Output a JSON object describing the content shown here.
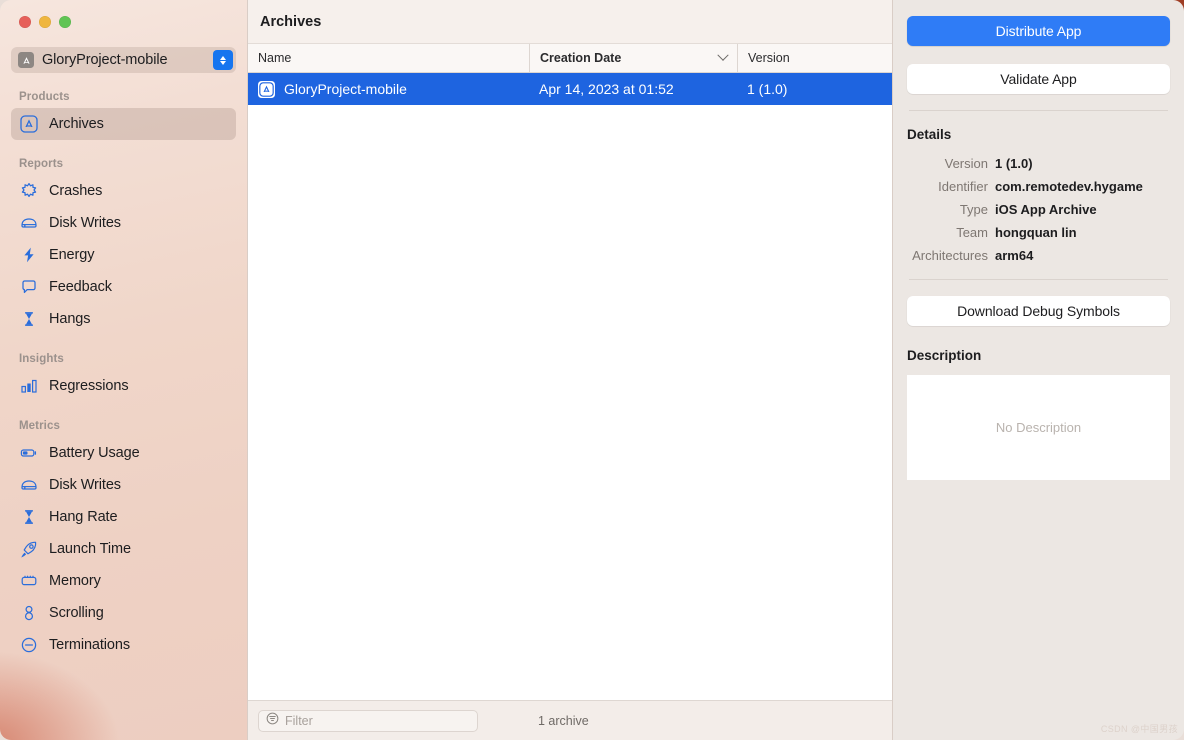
{
  "window": {
    "traffic_lights": [
      {
        "name": "close",
        "color": "#e6605a"
      },
      {
        "name": "minimize",
        "color": "#efb63f"
      },
      {
        "name": "zoom",
        "color": "#61c454"
      }
    ]
  },
  "sidebar": {
    "project_selector": {
      "label": "GloryProject-mobile",
      "icon": "xcode-project-icon",
      "stepper_icon": "up-down-chevron-icon"
    },
    "sections": [
      {
        "title": "Products",
        "items": [
          {
            "label": "Archives",
            "icon": "archive-box-icon",
            "selected": true
          }
        ]
      },
      {
        "title": "Reports",
        "items": [
          {
            "label": "Crashes",
            "icon": "crash-burst-icon",
            "selected": false
          },
          {
            "label": "Disk Writes",
            "icon": "disk-drive-icon",
            "selected": false
          },
          {
            "label": "Energy",
            "icon": "lightning-bolt-icon",
            "selected": false
          },
          {
            "label": "Feedback",
            "icon": "speech-bubble-icon",
            "selected": false
          },
          {
            "label": "Hangs",
            "icon": "hourglass-icon",
            "selected": false
          }
        ]
      },
      {
        "title": "Insights",
        "items": [
          {
            "label": "Regressions",
            "icon": "bar-chart-icon",
            "selected": false
          }
        ]
      },
      {
        "title": "Metrics",
        "items": [
          {
            "label": "Battery Usage",
            "icon": "battery-icon",
            "selected": false
          },
          {
            "label": "Disk Writes",
            "icon": "disk-drive-icon",
            "selected": false
          },
          {
            "label": "Hang Rate",
            "icon": "hourglass-icon",
            "selected": false
          },
          {
            "label": "Launch Time",
            "icon": "rocket-icon",
            "selected": false
          },
          {
            "label": "Memory",
            "icon": "memory-chip-icon",
            "selected": false
          },
          {
            "label": "Scrolling",
            "icon": "scroll-knot-icon",
            "selected": false
          },
          {
            "label": "Terminations",
            "icon": "minus-circle-icon",
            "selected": false
          }
        ]
      }
    ]
  },
  "main": {
    "title": "Archives",
    "table": {
      "columns": [
        "Name",
        "Creation Date",
        "Version"
      ],
      "sorted_column": "Creation Date",
      "sort_icon": "chevron-down-icon",
      "rows": [
        {
          "name": "GloryProject-mobile",
          "creation_date": "Apr 14, 2023 at 01:52",
          "version": "1 (1.0)",
          "icon": "archive-box-icon",
          "selected": true
        }
      ]
    },
    "footer": {
      "filter_icon": "filter-icon",
      "filter_placeholder": "Filter",
      "filter_value": "",
      "count_text": "1 archive"
    }
  },
  "inspector": {
    "distribute_label": "Distribute App",
    "validate_label": "Validate App",
    "details_heading": "Details",
    "details": [
      {
        "key": "Version",
        "value": "1 (1.0)"
      },
      {
        "key": "Identifier",
        "value": "com.remotedev.hygame"
      },
      {
        "key": "Type",
        "value": "iOS App Archive"
      },
      {
        "key": "Team",
        "value": "hongquan lin"
      },
      {
        "key": "Architectures",
        "value": "arm64"
      }
    ],
    "download_label": "Download Debug Symbols",
    "description_heading": "Description",
    "description_empty": "No Description"
  },
  "watermark": {
    "text": "CSDN @中国男孩"
  },
  "colors": {
    "accent_blue": "#2f7cf6",
    "selection_blue": "#1e64e0",
    "sidebar_icon_blue": "#2a6ddb",
    "panel_bg": "#ece7e3",
    "content_bg": "#ffffff"
  }
}
